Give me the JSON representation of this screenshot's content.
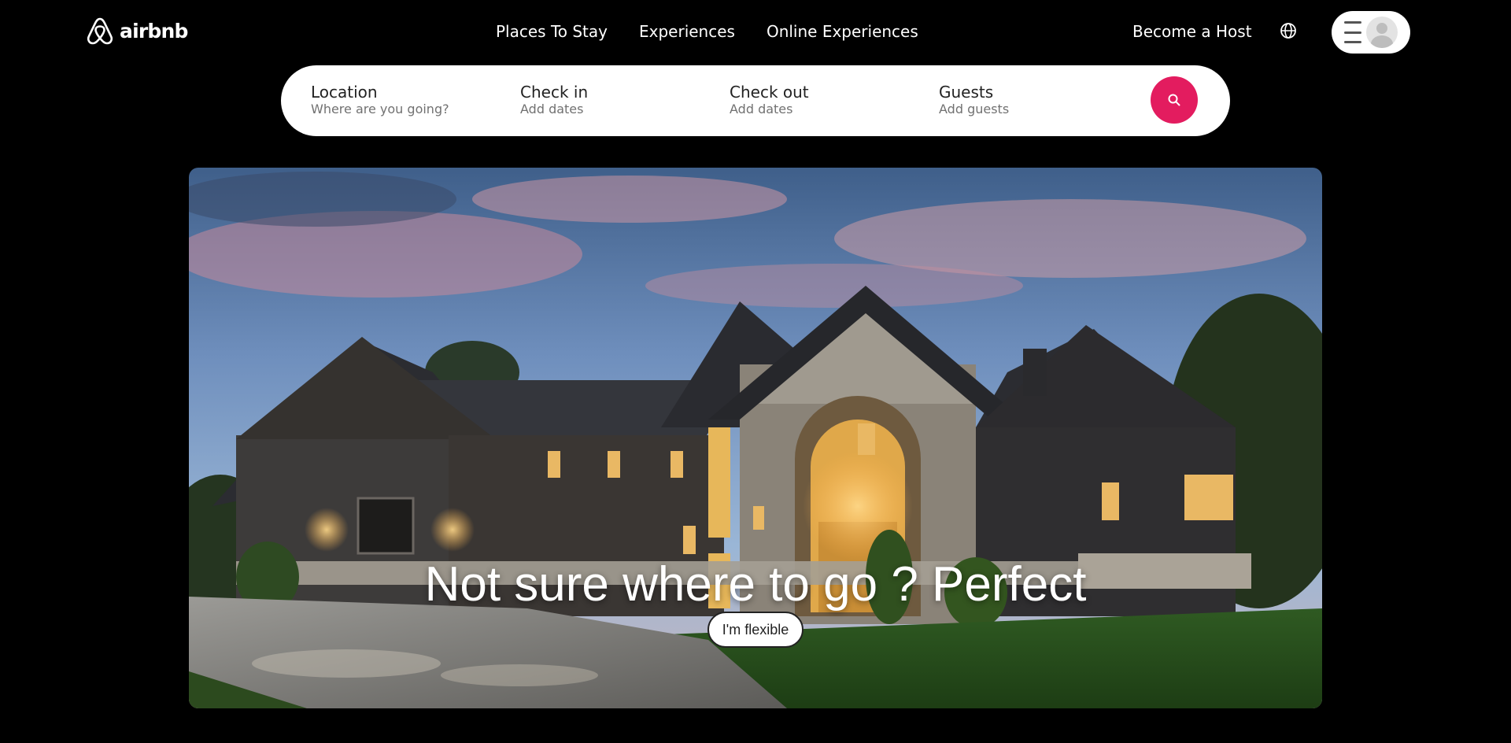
{
  "header": {
    "logo_text": "airbnb",
    "logo_icon": "airbnb-belo-icon",
    "nav": [
      {
        "label": "Places To Stay"
      },
      {
        "label": "Experiences"
      },
      {
        "label": "Online Experiences"
      }
    ],
    "host_link": "Become a Host",
    "globe_icon": "globe-icon",
    "menu_icon": "hamburger-menu-icon",
    "avatar_icon": "user-avatar-icon"
  },
  "search": {
    "fields": [
      {
        "label": "Location",
        "value": "Where are you going?"
      },
      {
        "label": "Check in",
        "value": "Add dates"
      },
      {
        "label": "Check out",
        "value": "Add dates"
      },
      {
        "label": "Guests",
        "value": "Add guests"
      }
    ],
    "button_icon": "search-icon",
    "button_color": "#e31c5f"
  },
  "hero": {
    "title": "Not sure where to go ? Perfect",
    "button_label": "I'm flexible"
  }
}
